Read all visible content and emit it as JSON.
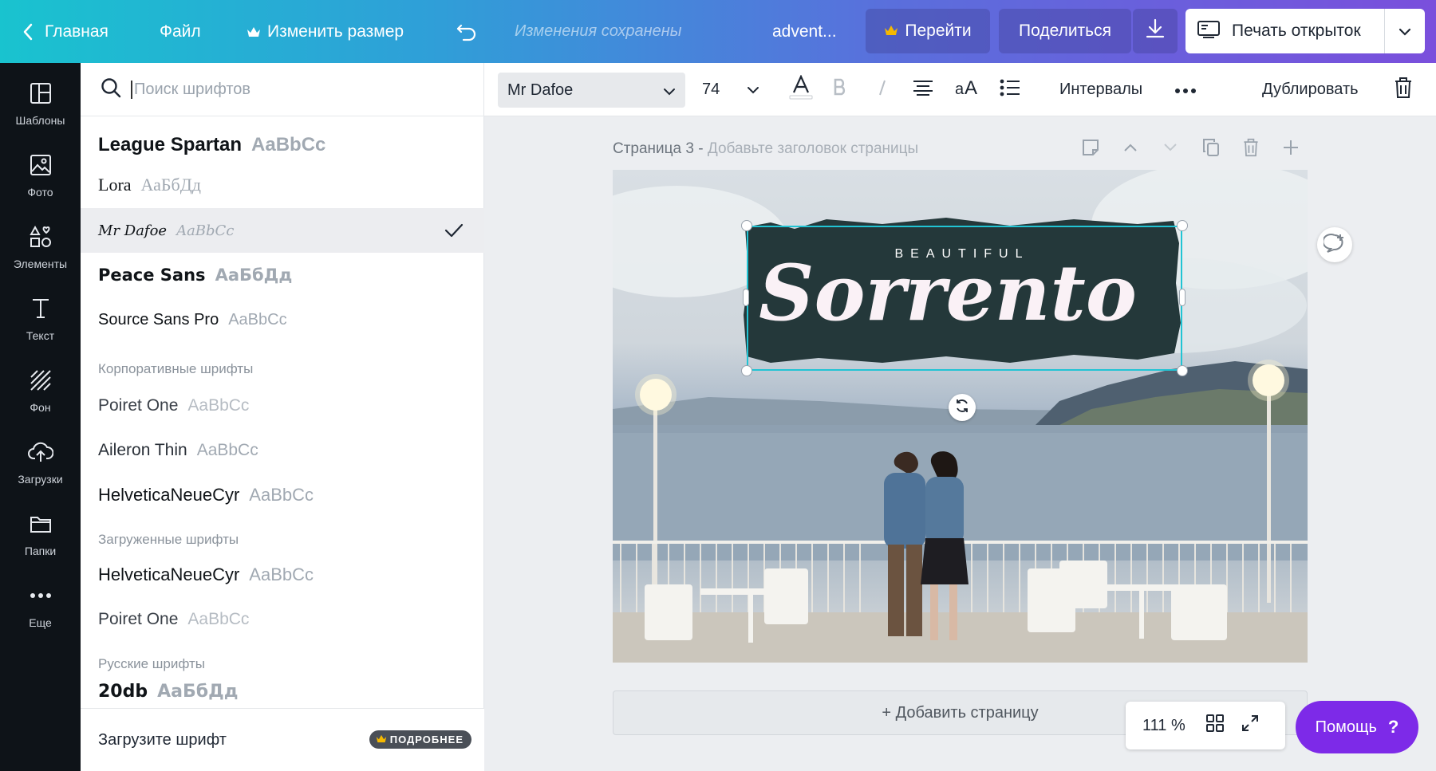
{
  "topbar": {
    "home_label": "Главная",
    "file_label": "Файл",
    "resize_label": "Изменить размер",
    "saved_status": "Изменения сохранены",
    "doc_title": "advent...",
    "upgrade_label": "Перейти",
    "share_label": "Поделиться",
    "print_label": "Печать открыток"
  },
  "rail": {
    "items": [
      {
        "label": "Шаблоны",
        "icon": "templates-icon"
      },
      {
        "label": "Фото",
        "icon": "photo-icon"
      },
      {
        "label": "Элементы",
        "icon": "elements-icon"
      },
      {
        "label": "Текст",
        "icon": "text-icon"
      },
      {
        "label": "Фон",
        "icon": "background-icon"
      },
      {
        "label": "Загрузки",
        "icon": "upload-icon"
      },
      {
        "label": "Папки",
        "icon": "folder-icon"
      },
      {
        "label": "Еще",
        "icon": "more-icon"
      }
    ]
  },
  "font_panel": {
    "search_placeholder": "Поиск шрифтов",
    "fonts_top": [
      {
        "name": "League Spartan",
        "sample": "AaBbCc"
      },
      {
        "name": "Lora",
        "sample": "АаБбДд"
      },
      {
        "name": "Mr Dafoe",
        "sample": "AaBbCc",
        "selected": true
      },
      {
        "name": "Peace Sans",
        "sample": "АаБбДд"
      },
      {
        "name": "Source Sans Pro",
        "sample": "AaBbCc"
      }
    ],
    "section_corporate": "Корпоративные шрифты",
    "fonts_corporate": [
      {
        "name": "Poiret One",
        "sample": "AaBbCc"
      },
      {
        "name": "Aileron Thin",
        "sample": "AaBbCc"
      },
      {
        "name": "HelveticaNeueCyr",
        "sample": "AaBbCc"
      }
    ],
    "section_uploaded": "Загруженные шрифты",
    "fonts_uploaded": [
      {
        "name": "HelveticaNeueCyr",
        "sample": "AaBbCc"
      },
      {
        "name": "Poiret One",
        "sample": "AaBbCc"
      }
    ],
    "section_russian": "Русские шрифты",
    "fonts_russian": [
      {
        "name": "20db",
        "sample": "АаБбДд"
      }
    ],
    "upload_label": "Загрузите шрифт",
    "more_badge": "ПОДРОБНЕЕ"
  },
  "toolbar": {
    "font_name": "Mr Dafoe",
    "font_size": "74",
    "spacing_label": "Интервалы",
    "duplicate_label": "Дублировать"
  },
  "canvas": {
    "page_prefix": "Страница 3 -",
    "page_title_placeholder": "Добавьте заголовок страницы",
    "heading_small": "BEAUTIFUL",
    "heading_big": "Sorrento",
    "add_page_label": "+ Добавить страницу"
  },
  "footer": {
    "zoom": "111 %",
    "help_label": "Помощь",
    "help_mark": "?"
  },
  "colors": {
    "banner": "#24383a",
    "selection": "#21c4d4",
    "help_button": "#7d2ae8"
  }
}
